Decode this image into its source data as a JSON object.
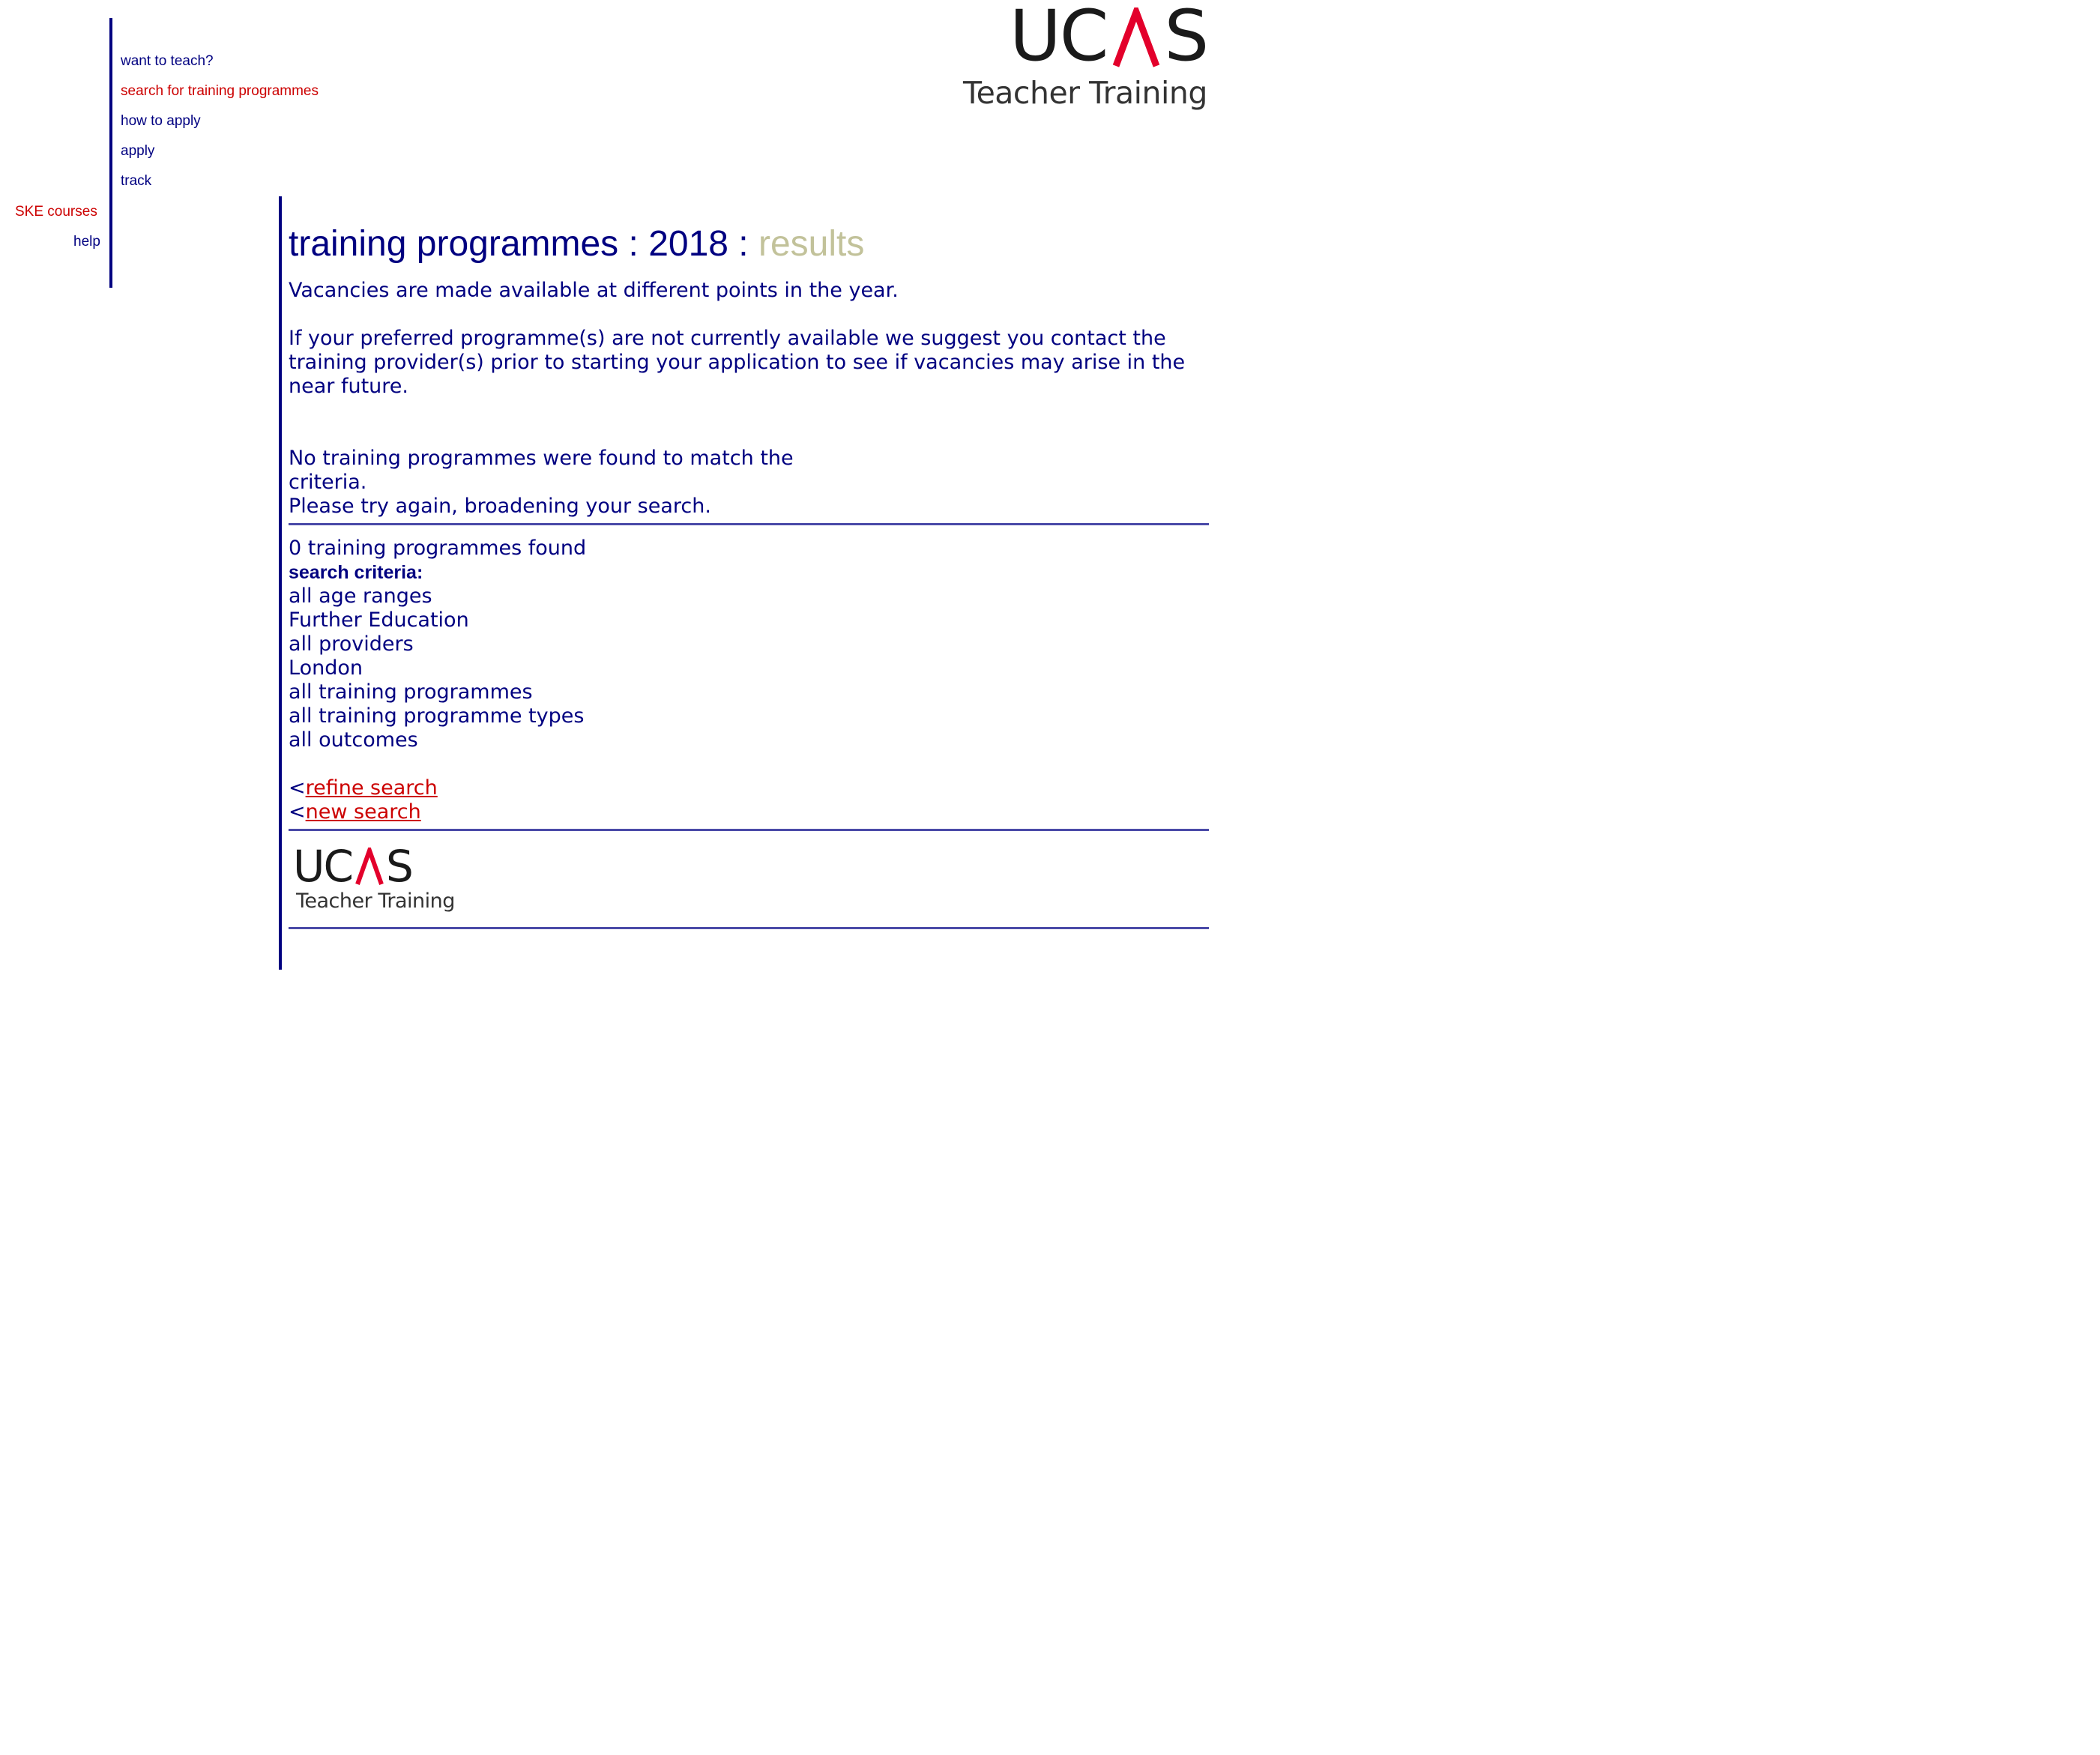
{
  "header": {
    "logo_word_left": "UC",
    "logo_word_right": "S",
    "logo_subtitle": "Teacher Training",
    "logo_caret_color": "#e3002b"
  },
  "nav": {
    "items": [
      {
        "label": "want to teach?"
      },
      {
        "label": "search for training programmes"
      },
      {
        "label": "how to apply"
      },
      {
        "label": "apply"
      },
      {
        "label": "track"
      },
      {
        "label": "SKE courses"
      },
      {
        "label": "help"
      }
    ]
  },
  "main": {
    "title_prefix": "training programmes : 2018 : ",
    "title_accent": "results",
    "intro_1": "Vacancies are made available at different points in the year.",
    "intro_2_line_1": "If your preferred programme(s) are not currently available we suggest you contact the",
    "intro_2_line_2": "training provider(s) prior to starting your application to see if vacancies may arise in the",
    "intro_2_line_3": "near future.",
    "no_results_line_1": "No training programmes were found to match the",
    "no_results_line_2": "criteria.",
    "no_results_line_3": "Please try again, broadening your search.",
    "count_text": "0 training programmes found",
    "criteria_label": "search criteria:",
    "criteria": [
      "all age ranges",
      "Further Education",
      "all providers",
      "London",
      "all training programmes",
      "all training programme types",
      "all outcomes"
    ],
    "link_prefix": "<",
    "refine_link": "refine search",
    "new_link": "new search"
  },
  "footer": {
    "logo_word_left": "UC",
    "logo_word_right": "S",
    "logo_subtitle": "Teacher Training"
  },
  "colors": {
    "text": "#000080",
    "active_nav": "#cc0000",
    "title_accent": "#c2c29a",
    "link": "#cc0000",
    "rule": "#000080"
  }
}
